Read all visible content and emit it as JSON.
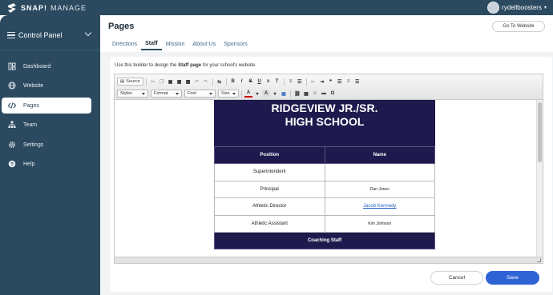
{
  "app": {
    "brand": "SNAP!",
    "brand_suffix": "MANAGE",
    "user": "rydellboosters"
  },
  "sidebar": {
    "header": "Control Panel",
    "items": [
      {
        "label": "Dashboard",
        "icon": "dashboard-icon"
      },
      {
        "label": "Website",
        "icon": "globe-icon"
      },
      {
        "label": "Pages",
        "icon": "code-icon",
        "active": true
      },
      {
        "label": "Team",
        "icon": "team-icon"
      },
      {
        "label": "Settings",
        "icon": "gear-icon"
      },
      {
        "label": "Help",
        "icon": "help-icon"
      }
    ]
  },
  "page": {
    "title": "Pages",
    "goto_button": "Go To Website",
    "tabs": [
      {
        "label": "Directions"
      },
      {
        "label": "Staff",
        "active": true
      },
      {
        "label": "Mission"
      },
      {
        "label": "About Us"
      },
      {
        "label": "Sponsors"
      }
    ],
    "intro_prefix": "Use this builder to design the",
    "intro_bold": "Staff page",
    "intro_suffix": "for your school's website."
  },
  "editor": {
    "toolbar": {
      "source_label": "Source",
      "styles": "Styles",
      "format": "Format",
      "font": "Font",
      "size": "Size"
    },
    "document": {
      "school_line1": "RIDGEVIEW JR./SR.",
      "school_line2": "HIGH SCHOOL",
      "col_position": "Position",
      "col_name": "Name",
      "rows": [
        {
          "position": "Superintendent",
          "name": ""
        },
        {
          "position": "Principal",
          "name": "Dan Jones"
        },
        {
          "position": "Athletic Director",
          "name": "Jacob Kennedy",
          "link": true
        },
        {
          "position": "Athletic Assistant",
          "name": "Kim Johnson"
        }
      ],
      "subhead": "Coaching Staff"
    }
  },
  "actions": {
    "cancel": "Cancel",
    "save": "Save"
  },
  "colors": {
    "sidebar": "#2b4a60",
    "banner": "#1f1a4e",
    "save": "#2e63d6",
    "link": "#2a64c5"
  }
}
